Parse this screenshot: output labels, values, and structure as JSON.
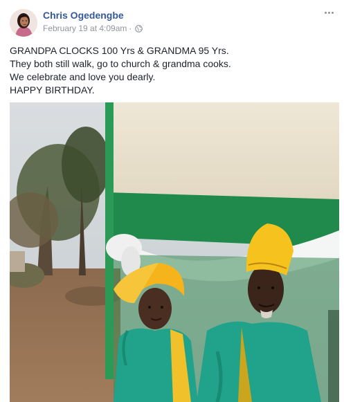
{
  "post": {
    "author": "Chris Ogedengbe",
    "timestamp": "February 19 at 4:09am",
    "separator": "·",
    "privacy_icon": "globe-icon",
    "menu_icon": "more-options-icon",
    "lines": [
      "GRANDPA CLOCKS 100 Yrs & GRANDMA 95 Yrs.",
      "They both still walk, go to church & grandma cooks.",
      "We celebrate and love you dearly.",
      "HAPPY BIRTHDAY."
    ]
  },
  "colors": {
    "author_link": "#365899",
    "meta_gray": "#90949c",
    "body_text": "#1d2129",
    "flag_green": "#1f8a4c",
    "gele_yellow": "#f5b41c",
    "attire_teal": "#21a28a"
  }
}
